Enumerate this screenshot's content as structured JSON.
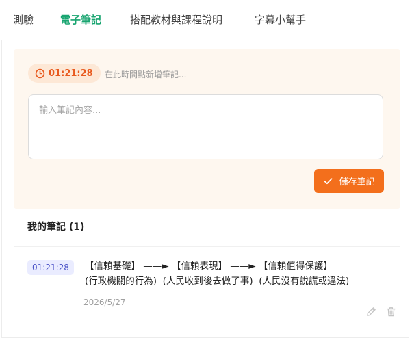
{
  "tabs": [
    {
      "label": "測驗"
    },
    {
      "label": "電子筆記"
    },
    {
      "label": "搭配教材與課程說明"
    },
    {
      "label": "字幕小幫手"
    }
  ],
  "editor": {
    "current_time": "01:21:28",
    "hint": "在此時間點新增筆記...",
    "placeholder": "輸入筆記內容...",
    "save_label": "儲存筆記"
  },
  "notes_section": {
    "title": "我的筆記 (1)",
    "items": [
      {
        "timestamp": "01:21:28",
        "line1": "【信賴基礎】 ——► 【信賴表現】 ——► 【信賴值得保護】",
        "line2": "(行政機關的行為)  (人民收到後去做了事)  (人民沒有說謊或違法)",
        "date": "2026/5/27"
      }
    ]
  },
  "colors": {
    "accent_green": "#1aa571",
    "accent_orange": "#f36f1c",
    "timestamp_badge": "#4d54c8"
  }
}
